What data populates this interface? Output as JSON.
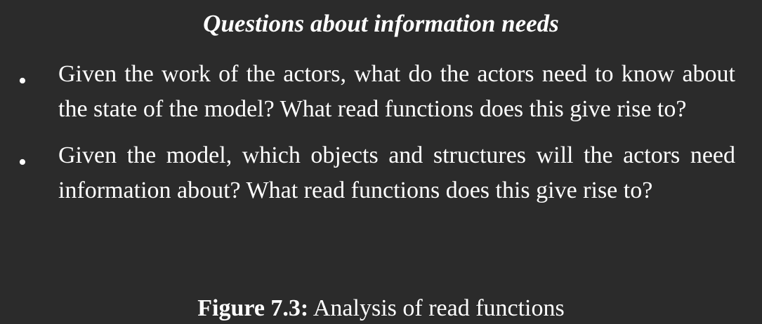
{
  "heading": "Questions about information needs",
  "bullets": [
    {
      "text": "Given the work of the actors, what do the actors need to know about the state of the model? What read functions does this give rise to?"
    },
    {
      "text": "Given the model, which objects and structures will the actors need information about? What read functions does this give rise to?"
    }
  ],
  "bullet_symbol": "•",
  "caption": {
    "label": "Figure 7.3:",
    "text": " Analysis of read functions"
  },
  "colors": {
    "background": "#2b2b2b",
    "text": "#ffffff"
  }
}
